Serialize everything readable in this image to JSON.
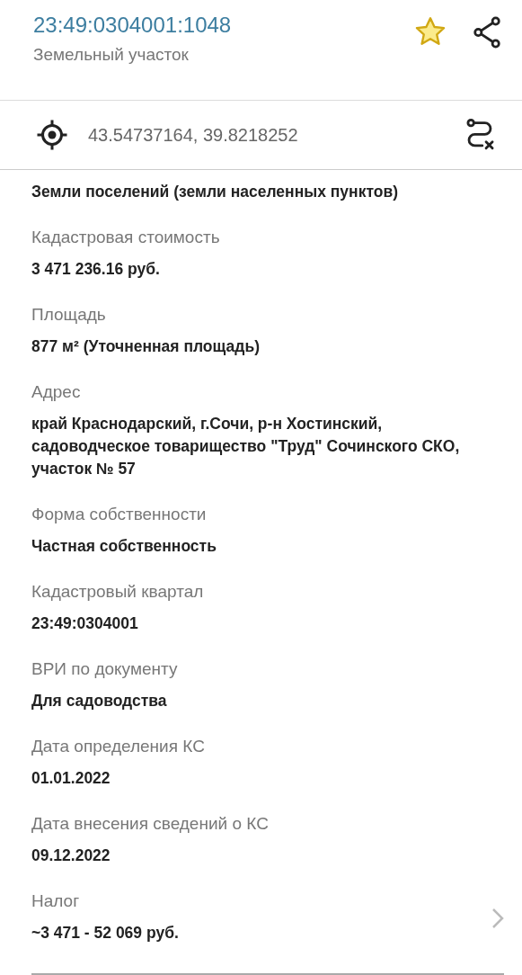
{
  "header": {
    "title": "23:49:0304001:1048",
    "subtitle": "Земельный участок",
    "favorite": true
  },
  "coordinates": "43.54737164, 39.8218252",
  "fields": [
    {
      "value": "Земли поселений (земли населенных пунктов)",
      "kind": "plain"
    },
    {
      "label": "Кадастровая стоимость",
      "value": "3 471 236.16 руб.",
      "kind": "plain"
    },
    {
      "label": "Площадь",
      "value": "877 м² (Уточненная площадь)",
      "kind": "plain"
    },
    {
      "label": "Адрес",
      "value": "край Краснодарский, г.Сочи, р-н Хостинский, садоводческое товарищество \"Труд\" Сочинского СКО, участок № 57",
      "kind": "plain"
    },
    {
      "label": "Форма собственности",
      "value": "Частная собственность",
      "kind": "plain"
    },
    {
      "label": "Кадастровый квартал",
      "value": "23:49:0304001",
      "kind": "plain"
    },
    {
      "label": "ВРИ по документу",
      "value": "Для садоводства",
      "kind": "plain"
    },
    {
      "label": "Дата определения КС",
      "value": "01.01.2022",
      "kind": "plain"
    },
    {
      "label": "Дата внесения сведений о КС",
      "value": "09.12.2022",
      "kind": "plain"
    },
    {
      "label": "Налог",
      "value": "~3 471 - 52 069 руб.",
      "kind": "link"
    }
  ]
}
